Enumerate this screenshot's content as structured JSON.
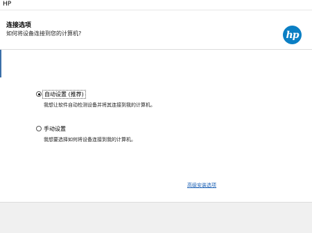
{
  "window": {
    "title": "HP"
  },
  "header": {
    "title": "连接选项",
    "subtitle": "如何将设备连接到您的计算机?",
    "logo_text": "hp",
    "logo_color": "#0b7fc4"
  },
  "options": [
    {
      "label": "自动设置 (推荐)",
      "description": "我想让软件自动检测设备并将其连接到我的计算机。",
      "selected": true
    },
    {
      "label": "手动设置",
      "description": "我想要选择如何将设备连接到我的计算机。",
      "selected": false
    }
  ],
  "advanced_link": "高级安装选项"
}
